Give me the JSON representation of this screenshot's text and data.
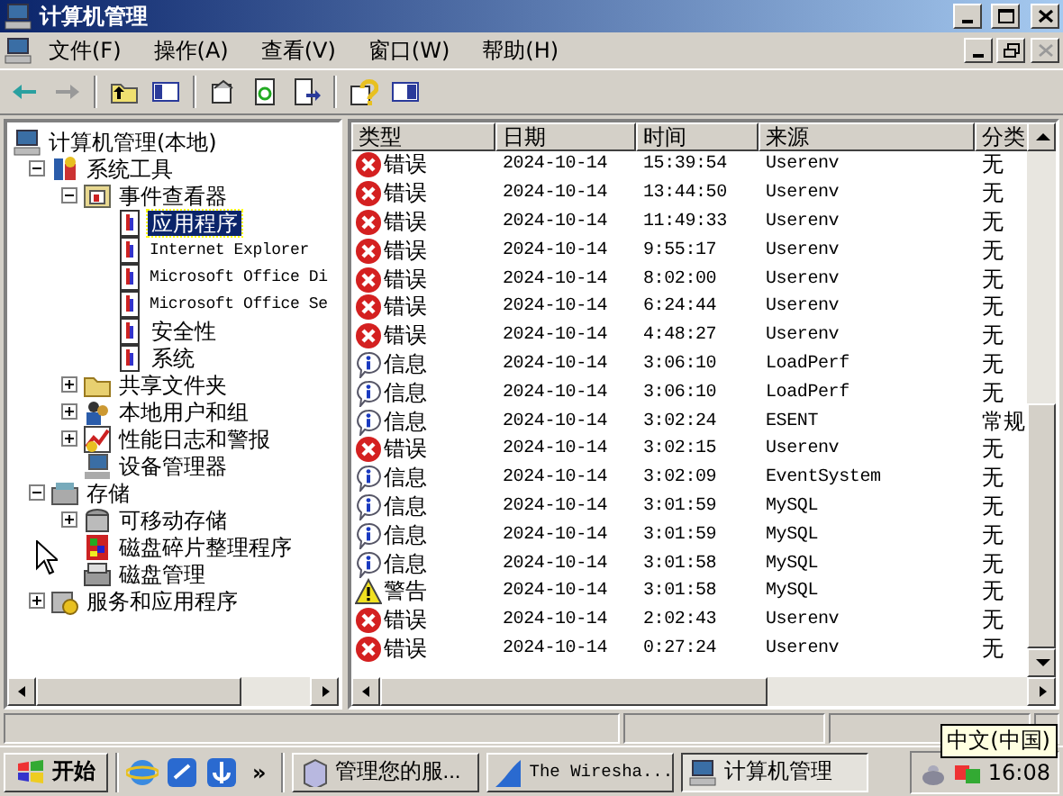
{
  "window": {
    "title": "计算机管理"
  },
  "menu": [
    "文件(F)",
    "操作(A)",
    "查看(V)",
    "窗口(W)",
    "帮助(H)"
  ],
  "tree": [
    {
      "label": "计算机管理(本地)",
      "selected": false,
      "children": [
        {
          "label": "系统工具",
          "selected": false,
          "expanded": true,
          "children": [
            {
              "label": "事件查看器",
              "selected": false,
              "expanded": true,
              "children": [
                {
                  "label": "应用程序",
                  "selected": true
                },
                {
                  "label": "Internet Explorer",
                  "selected": false
                },
                {
                  "label": "Microsoft Office Di",
                  "selected": false
                },
                {
                  "label": "Microsoft Office Se",
                  "selected": false
                },
                {
                  "label": "安全性",
                  "selected": false
                },
                {
                  "label": "系统",
                  "selected": false
                }
              ]
            },
            {
              "label": "共享文件夹",
              "selected": false,
              "expanded": false
            },
            {
              "label": "本地用户和组",
              "selected": false,
              "expanded": false
            },
            {
              "label": "性能日志和警报",
              "selected": false,
              "expanded": false
            },
            {
              "label": "设备管理器",
              "selected": false
            }
          ]
        },
        {
          "label": "存储",
          "selected": false,
          "expanded": true,
          "children": [
            {
              "label": "可移动存储",
              "selected": false,
              "expanded": false
            },
            {
              "label": "磁盘碎片整理程序",
              "selected": false
            },
            {
              "label": "磁盘管理",
              "selected": false
            }
          ]
        },
        {
          "label": "服务和应用程序",
          "selected": false,
          "expanded": false
        }
      ]
    }
  ],
  "events": {
    "columns": [
      "类型",
      "日期",
      "时间",
      "来源",
      "分类"
    ],
    "rows": [
      {
        "kind": "error",
        "type": "错误",
        "date": "2024-10-14",
        "time": "15:39:54",
        "source": "Userenv",
        "category": "无"
      },
      {
        "kind": "error",
        "type": "错误",
        "date": "2024-10-14",
        "time": "13:44:50",
        "source": "Userenv",
        "category": "无"
      },
      {
        "kind": "error",
        "type": "错误",
        "date": "2024-10-14",
        "time": "11:49:33",
        "source": "Userenv",
        "category": "无"
      },
      {
        "kind": "error",
        "type": "错误",
        "date": "2024-10-14",
        "time": "9:55:17",
        "source": "Userenv",
        "category": "无"
      },
      {
        "kind": "error",
        "type": "错误",
        "date": "2024-10-14",
        "time": "8:02:00",
        "source": "Userenv",
        "category": "无"
      },
      {
        "kind": "error",
        "type": "错误",
        "date": "2024-10-14",
        "time": "6:24:44",
        "source": "Userenv",
        "category": "无"
      },
      {
        "kind": "error",
        "type": "错误",
        "date": "2024-10-14",
        "time": "4:48:27",
        "source": "Userenv",
        "category": "无"
      },
      {
        "kind": "info",
        "type": "信息",
        "date": "2024-10-14",
        "time": "3:06:10",
        "source": "LoadPerf",
        "category": "无"
      },
      {
        "kind": "info",
        "type": "信息",
        "date": "2024-10-14",
        "time": "3:06:10",
        "source": "LoadPerf",
        "category": "无"
      },
      {
        "kind": "info",
        "type": "信息",
        "date": "2024-10-14",
        "time": "3:02:24",
        "source": "ESENT",
        "category": "常规"
      },
      {
        "kind": "error",
        "type": "错误",
        "date": "2024-10-14",
        "time": "3:02:15",
        "source": "Userenv",
        "category": "无"
      },
      {
        "kind": "info",
        "type": "信息",
        "date": "2024-10-14",
        "time": "3:02:09",
        "source": "EventSystem",
        "category": "无"
      },
      {
        "kind": "info",
        "type": "信息",
        "date": "2024-10-14",
        "time": "3:01:59",
        "source": "MySQL",
        "category": "无"
      },
      {
        "kind": "info",
        "type": "信息",
        "date": "2024-10-14",
        "time": "3:01:59",
        "source": "MySQL",
        "category": "无"
      },
      {
        "kind": "info",
        "type": "信息",
        "date": "2024-10-14",
        "time": "3:01:58",
        "source": "MySQL",
        "category": "无"
      },
      {
        "kind": "warning",
        "type": "警告",
        "date": "2024-10-14",
        "time": "3:01:58",
        "source": "MySQL",
        "category": "无"
      },
      {
        "kind": "error",
        "type": "错误",
        "date": "2024-10-14",
        "time": "2:02:43",
        "source": "Userenv",
        "category": "无"
      },
      {
        "kind": "error",
        "type": "错误",
        "date": "2024-10-14",
        "time": "0:27:24",
        "source": "Userenv",
        "category": "无"
      }
    ]
  },
  "taskbar": {
    "start": "开始",
    "more": "»",
    "tasks": [
      {
        "label": "管理您的服...",
        "selected": false
      },
      {
        "label": "The Wiresha...",
        "selected": false
      },
      {
        "label": "计算机管理",
        "selected": true
      }
    ],
    "clock": "16:08",
    "tooltip": "中文(中国)"
  }
}
